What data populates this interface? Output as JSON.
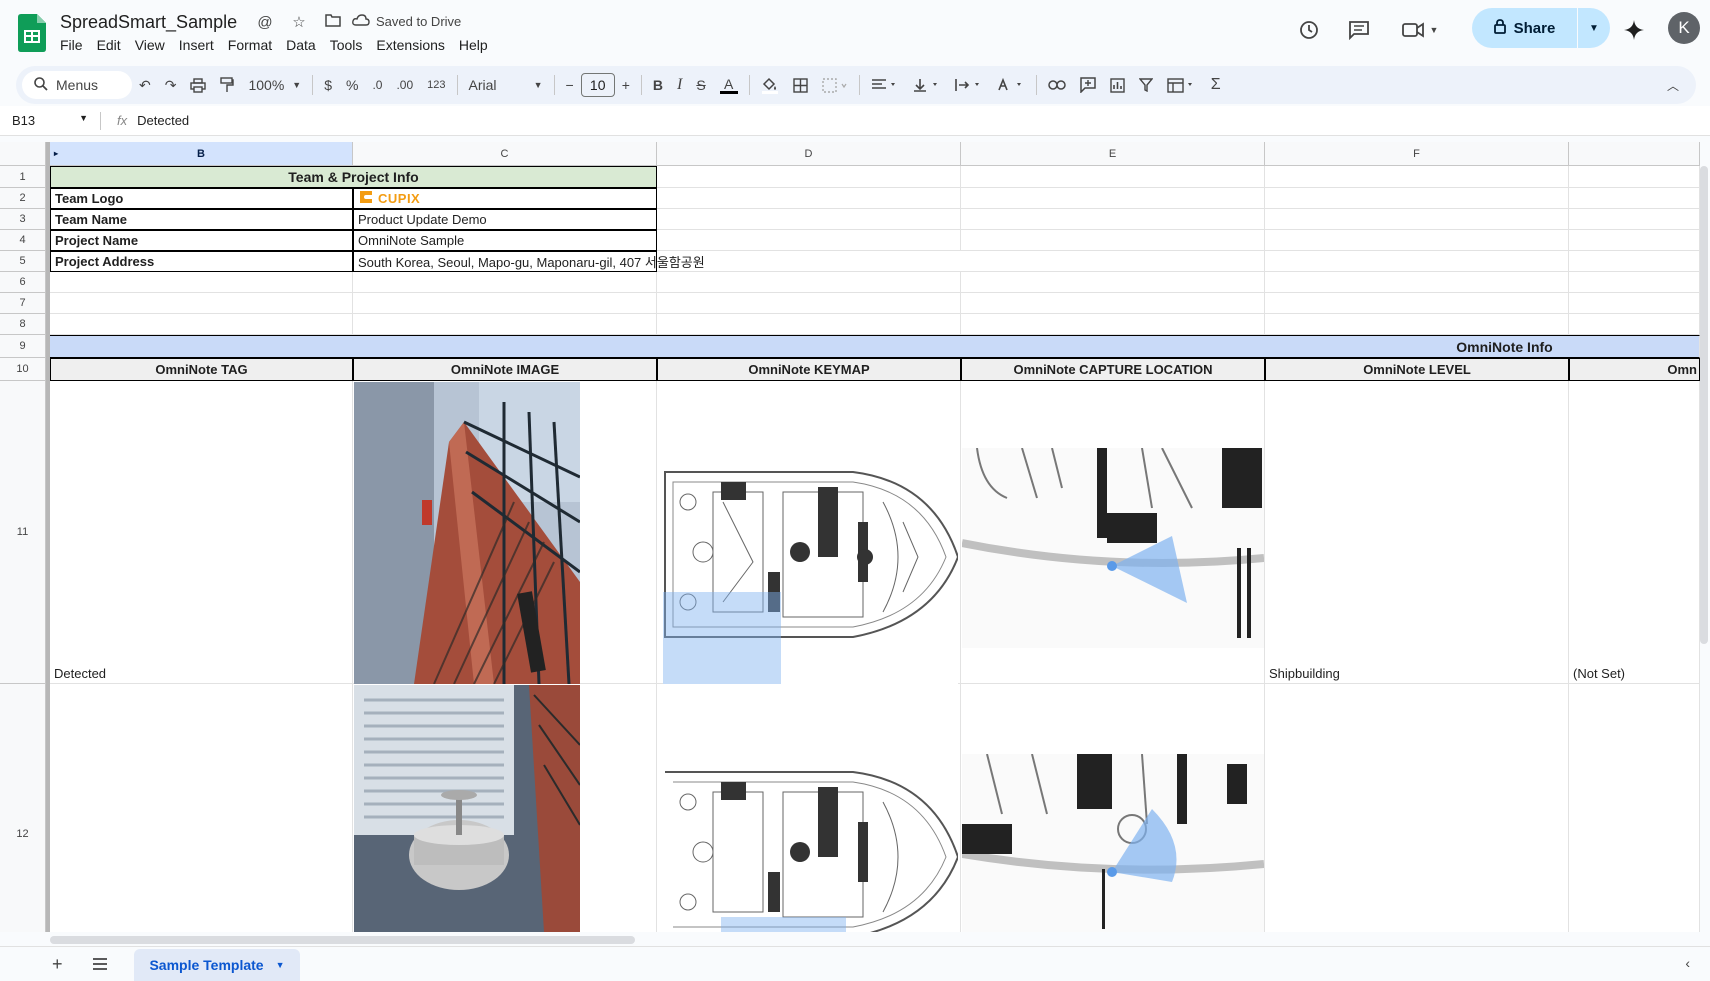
{
  "app": {
    "doc_title": "SpreadSmart_Sample",
    "saved_status": "Saved to Drive",
    "menu": [
      "File",
      "Edit",
      "View",
      "Insert",
      "Format",
      "Data",
      "Tools",
      "Extensions",
      "Help"
    ],
    "share_label": "Share",
    "avatar_letter": "K",
    "accent_color": "#0f9d58"
  },
  "toolbar": {
    "menus_label": "Menus",
    "zoom": "100%",
    "currency": "$",
    "percent": "%",
    "dec_decrease": ".0",
    "dec_increase": ".00",
    "number_format": "123",
    "font": "Arial",
    "font_size": "10",
    "bold": "B",
    "italic": "I"
  },
  "formula_bar": {
    "cell_ref": "B13",
    "fx": "fx",
    "content": "Detected"
  },
  "grid": {
    "columns": [
      "B",
      "C",
      "D",
      "E",
      "F",
      ""
    ],
    "rows": [
      "1",
      "2",
      "3",
      "4",
      "5",
      "6",
      "7",
      "8",
      "9",
      "10",
      "11",
      "12"
    ],
    "team_header": "Team & Project Info",
    "team_rows": [
      {
        "label": "Team Logo",
        "value": "CUPIX"
      },
      {
        "label": "Team Name",
        "value": "Product Update Demo"
      },
      {
        "label": "Project Name",
        "value": "OmniNote Sample"
      },
      {
        "label": "Project Address",
        "value": "South Korea, Seoul, Mapo-gu, Maponaru-gil, 407 서울함공원"
      }
    ],
    "omninote_header": "OmniNote Info",
    "table_headers": [
      "OmniNote TAG",
      "OmniNote IMAGE",
      "OmniNote KEYMAP",
      "OmniNote CAPTURE LOCATION",
      "OmniNote LEVEL",
      "Omn"
    ],
    "row11": {
      "tag": "Detected",
      "level": "Shipbuilding",
      "extra": "(Not Set)"
    }
  },
  "sheets": {
    "active": "Sample Template"
  }
}
